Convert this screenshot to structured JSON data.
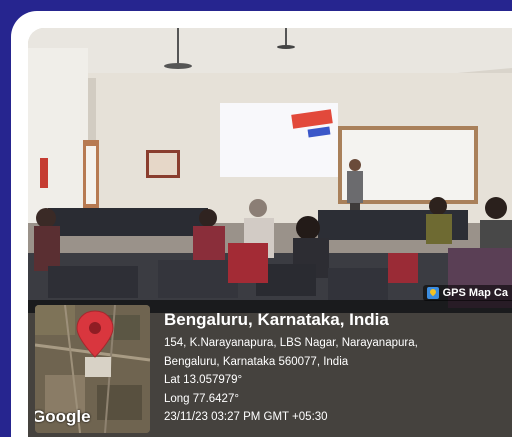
{
  "gps_badge": {
    "label": "GPS Map Ca",
    "icon": "gps-map-camera-icon"
  },
  "location": {
    "city": "Bengaluru, Karnataka, India",
    "address_line1": "154, K.Narayanapura, LBS Nagar, Narayanapura,",
    "address_line2": "Bengaluru, Karnataka 560077, India",
    "lat": "Lat 13.057979°",
    "long": "Long 77.6427°",
    "datetime": "23/11/23 03:27 PM GMT +05:30"
  },
  "map": {
    "provider": "Google",
    "pin_color": "#d9363e"
  },
  "colors": {
    "frame": "#26258f",
    "card": "#ffffff",
    "overlay": "rgba(0,0,0,0.55)"
  }
}
